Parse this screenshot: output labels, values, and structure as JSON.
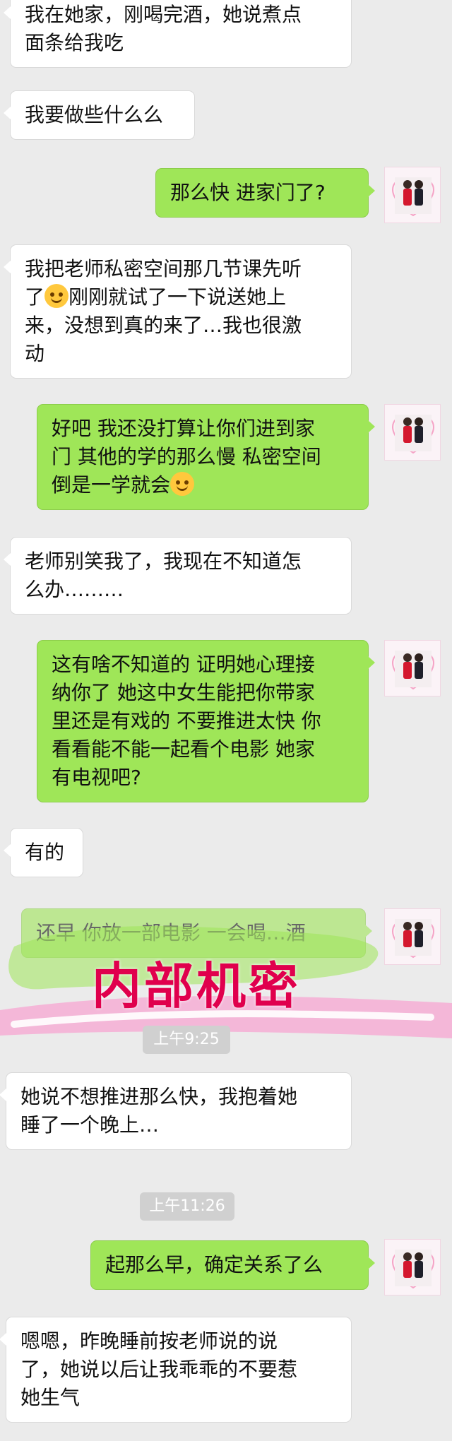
{
  "messages": [
    {
      "side": "left",
      "text": "我在她家，刚喝完酒，她说煮点\n面条给我吃"
    },
    {
      "side": "left",
      "text": "我要做些什么么"
    },
    {
      "side": "right",
      "text": "那么快 进家门了?"
    },
    {
      "side": "left",
      "text_before": "我把老师私密空间那几节课先听\n了",
      "emoji": "tears-of-joy-emoji",
      "text_after": "刚刚就试了一下说送她上\n来，没想到真的来了…我也很激\n动"
    },
    {
      "side": "right",
      "text_before": "好吧 我还没打算让你们进到家\n门 其他的学的那么慢 私密空间\n倒是一学就会",
      "emoji": "blush-emoji"
    },
    {
      "side": "left",
      "text": "老师别笑我了，我现在不知道怎\n么办………"
    },
    {
      "side": "right",
      "text": "这有啥不知道的 证明她心理接\n纳你了 她这中女生能把你带家\n里还是有戏的 不要推进太快 你\n看看能不能一起看个电影 她家\n有电视吧?"
    },
    {
      "side": "left",
      "text": "有的"
    },
    {
      "side": "right",
      "text": "还早 你放一部电影 一会喝…酒"
    },
    {
      "side": "left",
      "text": "她说不想推进那么快，我抱着她\n睡了一个晚上…"
    },
    {
      "side": "right",
      "text": "起那么早，确定关系了么"
    },
    {
      "side": "left",
      "text": "嗯嗯，昨晚睡前按老师说的说\n了，她说以后让我乖乖的不要惹\n她生气"
    }
  ],
  "timestamps": [
    "上午9:25",
    "上午11:26"
  ],
  "watermark": "内部机密",
  "colors": {
    "background": "#ebebeb",
    "received": "#ffffff",
    "sent": "#9fe658",
    "watermark": "#e0004d",
    "timestamp": "#d0d0d0"
  },
  "avatar": {
    "icon": "two-women-avatar-icon"
  }
}
